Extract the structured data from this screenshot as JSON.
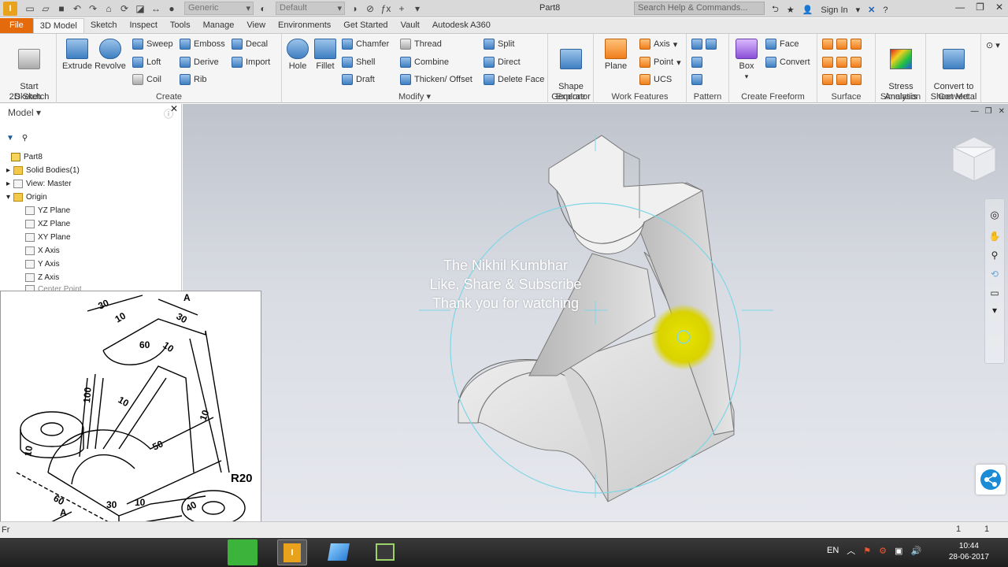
{
  "app": {
    "document_title": "Part8",
    "search_placeholder": "Search Help & Commands...",
    "sign_in": "Sign In",
    "material_dropdown": "Generic",
    "appearance_dropdown": "Default"
  },
  "tabs": [
    "File",
    "3D Model",
    "Sketch",
    "Inspect",
    "Tools",
    "Manage",
    "View",
    "Environments",
    "Get Started",
    "Vault",
    "Autodesk A360"
  ],
  "ribbon": {
    "sketch": {
      "title": "Sketch",
      "start": "Start\n2D Sketch"
    },
    "create": {
      "title": "Create",
      "extrude": "Extrude",
      "revolve": "Revolve",
      "sweep": "Sweep",
      "loft": "Loft",
      "coil": "Coil",
      "emboss": "Emboss",
      "derive": "Derive",
      "rib": "Rib",
      "decal": "Decal",
      "import": "Import"
    },
    "modify": {
      "title": "Modify",
      "hole": "Hole",
      "fillet": "Fillet",
      "chamfer": "Chamfer",
      "shell": "Shell",
      "draft": "Draft",
      "thread": "Thread",
      "combine": "Combine",
      "thicken": "Thicken/ Offset",
      "split": "Split",
      "direct": "Direct",
      "delete_face": "Delete Face"
    },
    "explore": {
      "title": "Explore",
      "shape_generator": "Shape\nGenerator"
    },
    "work_features": {
      "title": "Work Features",
      "plane": "Plane",
      "axis": "Axis",
      "point": "Point",
      "ucs": "UCS"
    },
    "pattern": {
      "title": "Pattern"
    },
    "create_freeform": {
      "title": "Create Freeform",
      "box": "Box",
      "face": "Face",
      "convert": "Convert"
    },
    "surface": {
      "title": "Surface"
    },
    "simulation": {
      "title": "Simulation",
      "stress": "Stress\nAnalysis"
    },
    "convert": {
      "title": "Convert",
      "sheet_metal": "Convert to\nSheet Metal"
    }
  },
  "browser": {
    "title": "Model",
    "items": [
      "Part8",
      "Solid Bodies(1)",
      "View: Master",
      "Origin",
      "YZ Plane",
      "XZ Plane",
      "XY Plane",
      "X Axis",
      "Y Axis",
      "Z Axis",
      "Center Point"
    ]
  },
  "watermark": {
    "line1": "The Nikhil Kumbhar",
    "line2": "Like, Share & Subscribe",
    "line3": "Thank you for watching"
  },
  "drawing": {
    "labels": [
      "30",
      "A",
      "30",
      "10",
      "60",
      "10",
      "100",
      "10",
      "10",
      "50",
      "10",
      "R20",
      "30",
      "10",
      "40",
      "60",
      "60",
      "10",
      "A",
      "X"
    ]
  },
  "status": {
    "left": "Fr",
    "count1": "1",
    "count2": "1"
  },
  "tray": {
    "lang": "EN",
    "time": "10:44",
    "date": "28-06-2017"
  },
  "colors": {
    "file_tab": "#e56a0b",
    "highlight": "#e0e000",
    "orbit_ring": "#7fd6e6"
  }
}
